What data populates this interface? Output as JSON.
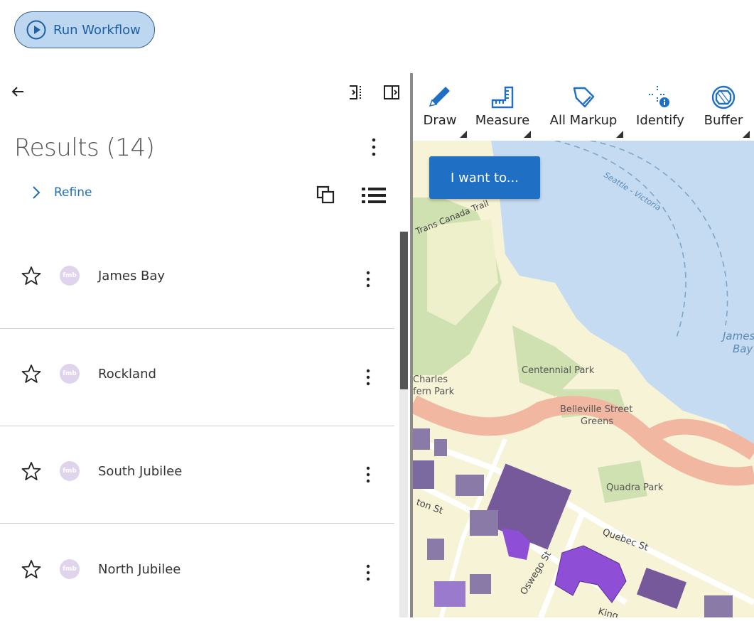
{
  "header": {
    "run_workflow_label": "Run Workflow"
  },
  "panel": {
    "results_title": "Results (14)",
    "refine_label": "Refine",
    "results": [
      {
        "name": "James Bay",
        "badge": "fmb"
      },
      {
        "name": "Rockland",
        "badge": "fmb"
      },
      {
        "name": "South Jubilee",
        "badge": "fmb"
      },
      {
        "name": "North Jubilee",
        "badge": "fmb"
      }
    ]
  },
  "toolbar": {
    "tools": [
      {
        "label": "Draw",
        "icon": "pencil-icon"
      },
      {
        "label": "Measure",
        "icon": "ruler-icon"
      },
      {
        "label": "All Markup",
        "icon": "markup-tag-icon"
      },
      {
        "label": "Identify",
        "icon": "identify-icon"
      },
      {
        "label": "Buffer",
        "icon": "buffer-icon"
      }
    ]
  },
  "map": {
    "i_want_to_label": "I want to...",
    "labels": {
      "trail": "Trans Canada Trail",
      "ferry": "Seattle - Victoria",
      "bay_line1": "James",
      "bay_line2": "Bay",
      "centennial": "Centennial Park",
      "charles1": "Charles",
      "charles2": "fern Park",
      "belleville1": "Belleville Street",
      "belleville2": "Greens",
      "quadra": "Quadra Park",
      "quebec": "Quebec St",
      "oswego": "Oswego St",
      "ton_st": "ton St",
      "king": "King"
    },
    "colors": {
      "water": "#c4dbf2",
      "land": "#f6f3d6",
      "park": "#cfe1b0",
      "road": "#f1b7a0",
      "building": "#8a7aa8",
      "highlight": "#8e4fd6"
    }
  }
}
